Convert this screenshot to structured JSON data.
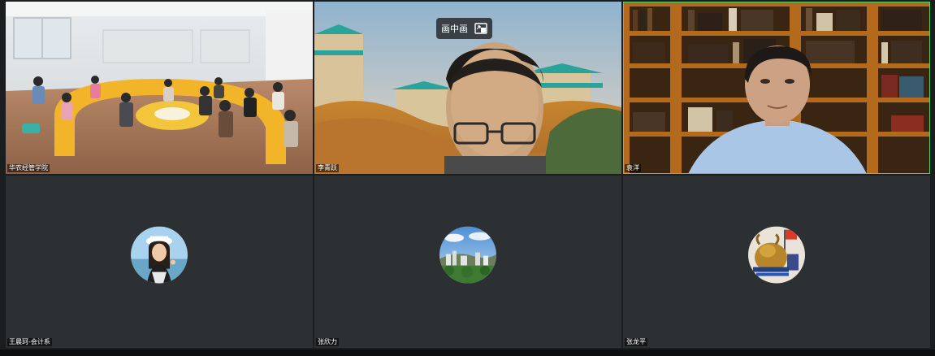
{
  "pip_label": "画中画",
  "tiles": [
    {
      "name": "华农经管学院",
      "type": "video"
    },
    {
      "name": "李青跃",
      "type": "video"
    },
    {
      "name": "袁洋",
      "type": "video"
    },
    {
      "name": "王晨珂-会计系",
      "type": "avatar"
    },
    {
      "name": "张欣力",
      "type": "avatar"
    },
    {
      "name": "张龙平",
      "type": "avatar"
    }
  ],
  "colors": {
    "background": "#1b1d1f",
    "tile": "#2d3033",
    "active_speaker": "#4fd06b"
  }
}
